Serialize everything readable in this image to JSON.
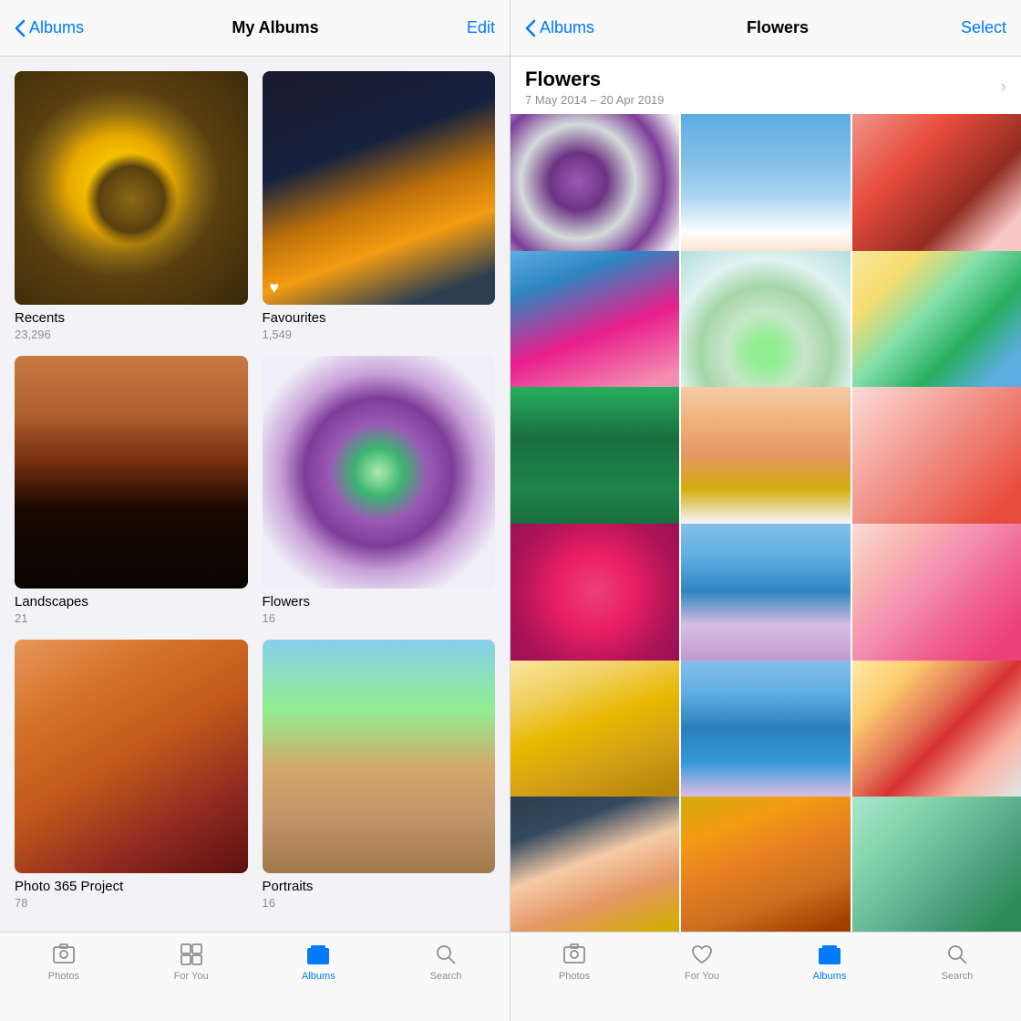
{
  "left": {
    "nav": {
      "back_label": "Albums",
      "title": "My Albums",
      "action_label": "Edit"
    },
    "albums": [
      {
        "id": "recents",
        "name": "Recents",
        "count": "23,296",
        "thumb_class": "thumb-recents",
        "has_heart": false
      },
      {
        "id": "favourites",
        "name": "Favourites",
        "count": "1,549",
        "thumb_class": "thumb-favourites",
        "has_heart": true
      },
      {
        "id": "landscapes",
        "name": "Landscapes",
        "count": "21",
        "thumb_class": "thumb-landscapes",
        "has_heart": false
      },
      {
        "id": "flowers",
        "name": "Flowers",
        "count": "16",
        "thumb_class": "thumb-flowers",
        "has_heart": false
      },
      {
        "id": "photo365",
        "name": "Photo 365 Project",
        "count": "78",
        "thumb_class": "thumb-photo365",
        "has_heart": false
      },
      {
        "id": "portraits",
        "name": "Portraits",
        "count": "16",
        "thumb_class": "thumb-portraits",
        "has_heart": false
      }
    ],
    "tabs": [
      {
        "id": "photos",
        "label": "Photos",
        "active": false
      },
      {
        "id": "for-you",
        "label": "For You",
        "active": false
      },
      {
        "id": "albums",
        "label": "Albums",
        "active": true
      },
      {
        "id": "search",
        "label": "Search",
        "active": false
      }
    ]
  },
  "right": {
    "nav": {
      "back_label": "Albums",
      "title": "Flowers",
      "action_label": "Select"
    },
    "header": {
      "title": "Flowers",
      "date_range": "7 May 2014 – 20 Apr 2019"
    },
    "photos": [
      {
        "id": "rp1",
        "class": "p1",
        "heart": true
      },
      {
        "id": "rp2",
        "class": "p2",
        "heart": true
      },
      {
        "id": "rp3",
        "class": "p3",
        "heart": false
      },
      {
        "id": "rp4",
        "class": "p4",
        "heart": true
      },
      {
        "id": "rp5",
        "class": "p5",
        "heart": true
      },
      {
        "id": "rp6",
        "class": "p6",
        "heart": true
      },
      {
        "id": "rp7",
        "class": "p7",
        "heart": false
      },
      {
        "id": "rp8",
        "class": "p8",
        "heart": false
      },
      {
        "id": "rp9",
        "class": "p9",
        "heart": false
      },
      {
        "id": "rp10",
        "class": "p10",
        "heart": false
      },
      {
        "id": "rp11",
        "class": "p11",
        "heart": true
      },
      {
        "id": "rp12",
        "class": "p12",
        "heart": true
      },
      {
        "id": "rp13",
        "class": "p13",
        "heart": false
      },
      {
        "id": "rp14",
        "class": "p14",
        "heart": false
      },
      {
        "id": "rp15",
        "class": "p15",
        "heart": false
      },
      {
        "id": "rp16",
        "class": "p16",
        "heart": false
      },
      {
        "id": "rp17",
        "class": "p17",
        "heart": false
      },
      {
        "id": "rp18",
        "class": "p18",
        "heart": false
      }
    ],
    "tabs": [
      {
        "id": "photos",
        "label": "Photos",
        "active": false
      },
      {
        "id": "for-you",
        "label": "For You",
        "active": false
      },
      {
        "id": "albums",
        "label": "Albums",
        "active": true
      },
      {
        "id": "search",
        "label": "Search",
        "active": false
      }
    ]
  }
}
